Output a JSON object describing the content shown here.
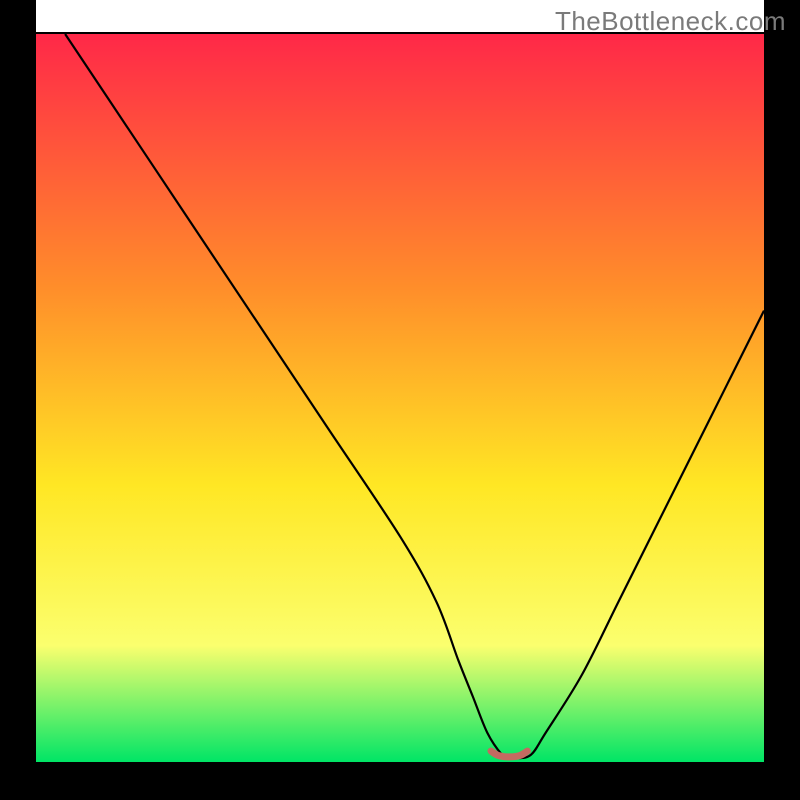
{
  "watermark": "TheBottleneck.com",
  "colors": {
    "gradient_top": "#ff2848",
    "gradient_mid1": "#ff8e2a",
    "gradient_mid2": "#ffe724",
    "gradient_mid3": "#fbff6e",
    "gradient_bottom": "#00e566",
    "curve": "#000000",
    "frame": "#000000",
    "marker": "#c46a61"
  },
  "chart_data": {
    "type": "line",
    "title": "",
    "xlabel": "",
    "ylabel": "",
    "xlim": [
      0,
      100
    ],
    "ylim": [
      0,
      100
    ],
    "grid": false,
    "curve": {
      "x": [
        4,
        10,
        20,
        30,
        40,
        50,
        55,
        58,
        60,
        62,
        64,
        65,
        66,
        68,
        70,
        75,
        80,
        85,
        90,
        95,
        100
      ],
      "y": [
        100,
        91,
        76,
        61,
        46,
        31,
        22,
        14,
        9,
        4,
        1,
        0.5,
        0.5,
        1,
        4,
        12,
        22,
        32,
        42,
        52,
        62
      ]
    },
    "marker": {
      "x": [
        62.5,
        63.5,
        65,
        66.5,
        67.5
      ],
      "y": [
        1.5,
        0.9,
        0.7,
        0.9,
        1.5
      ]
    }
  }
}
